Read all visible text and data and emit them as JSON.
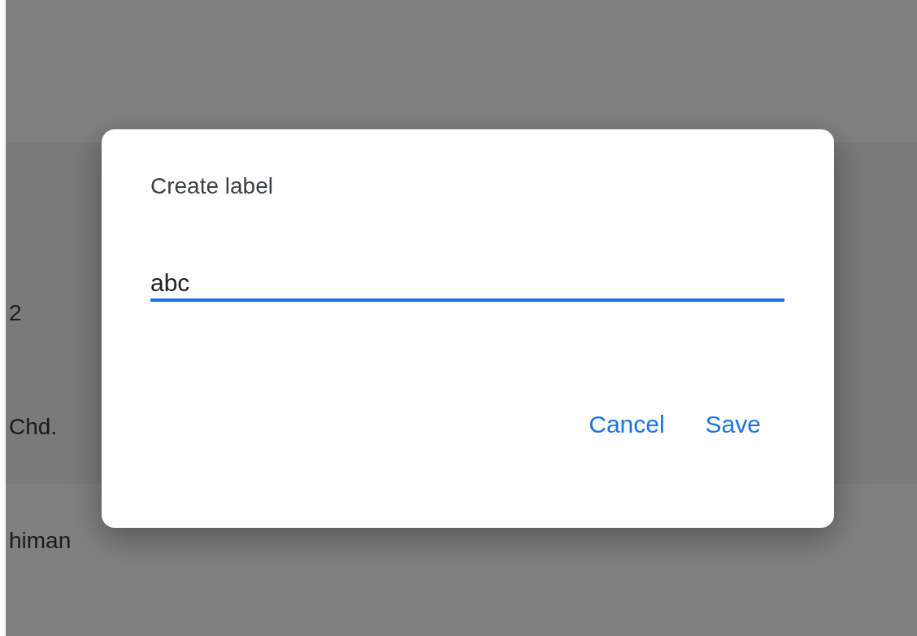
{
  "background_rows": [
    {
      "text": "2"
    },
    {
      "text": "Chd."
    },
    {
      "text": "himan"
    }
  ],
  "dialog": {
    "title": "Create label",
    "field": {
      "value": "abc",
      "focused": true
    },
    "buttons": [
      "Cancel",
      "Save"
    ]
  }
}
